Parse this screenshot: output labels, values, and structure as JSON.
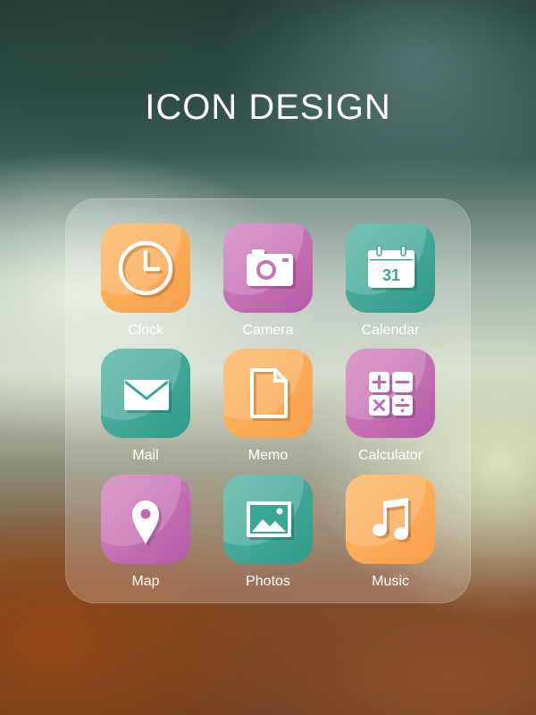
{
  "header": {
    "title": "ICON DESIGN"
  },
  "colors": {
    "orange": "#f8a04f",
    "pink": "#c06aae",
    "teal": "#3aa696",
    "label": "#ffffff"
  },
  "apps": [
    {
      "label": "Clock",
      "icon": "clock-icon",
      "color": "orange"
    },
    {
      "label": "Camera",
      "icon": "camera-icon",
      "color": "pink"
    },
    {
      "label": "Calendar",
      "icon": "calendar-icon",
      "color": "teal",
      "badge": "31"
    },
    {
      "label": "Mail",
      "icon": "mail-icon",
      "color": "teal"
    },
    {
      "label": "Memo",
      "icon": "memo-icon",
      "color": "orange"
    },
    {
      "label": "Calculator",
      "icon": "calculator-icon",
      "color": "pink"
    },
    {
      "label": "Map",
      "icon": "map-pin-icon",
      "color": "pink"
    },
    {
      "label": "Photos",
      "icon": "photos-icon",
      "color": "teal"
    },
    {
      "label": "Music",
      "icon": "music-note-icon",
      "color": "orange"
    }
  ]
}
